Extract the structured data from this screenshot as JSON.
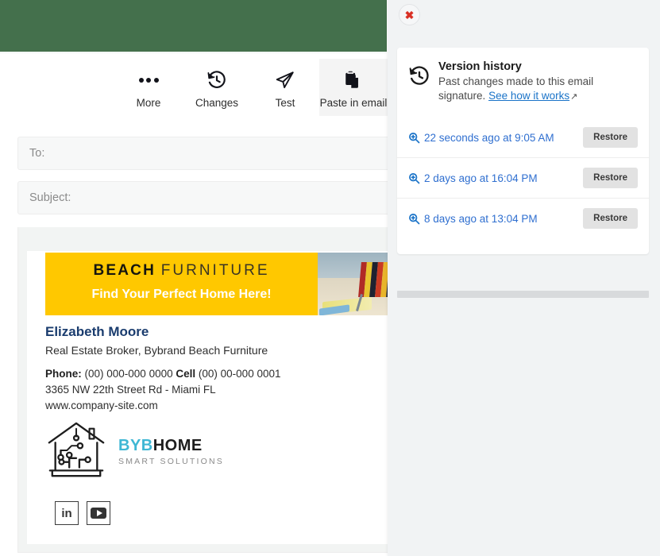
{
  "app": {
    "header_color": "#44704c",
    "panel_bg": "#f1f3f4"
  },
  "toolbar": {
    "items": [
      {
        "label": "More",
        "icon": "ellipsis-icon",
        "active": false
      },
      {
        "label": "Changes",
        "icon": "history-clock-icon",
        "active": false
      },
      {
        "label": "Test",
        "icon": "paper-plane-icon",
        "active": false
      },
      {
        "label": "Paste in email",
        "icon": "clipboard-paste-icon",
        "active": true
      }
    ]
  },
  "compose": {
    "to_label": "To:",
    "to_value": "",
    "subject_label": "Subject:",
    "subject_value": ""
  },
  "signature": {
    "banner": {
      "title_strong": "BEACH",
      "title_light": "FURNITURE",
      "subtitle": "Find Your Perfect Home Here!",
      "bg_color": "#ffc800"
    },
    "name": "Elizabeth Moore",
    "role": "Real Estate Broker,  Bybrand Beach Furniture",
    "phone_label": "Phone:",
    "phone_value": "(00) 000-000 0000",
    "cell_label": "Cell",
    "cell_value": "(00) 00-000 0001",
    "address": "3365 NW 22th Street Rd - Miami FL",
    "website": "www.company-site.com",
    "logo": {
      "brand_primary": "BYB",
      "brand_secondary": "HOME",
      "tagline": "SMART SOLUTIONS",
      "primary_color": "#3fb7d4"
    },
    "social": [
      {
        "name": "linkedin",
        "glyph": "in"
      },
      {
        "name": "youtube",
        "glyph": "play"
      }
    ]
  },
  "panel": {
    "close_label": "✖",
    "title": "Version history",
    "description": "Past changes made to this email signature.",
    "link_text": "See how it works",
    "link_external_icon": "↗",
    "versions": [
      {
        "label": "22 seconds ago at 9:05 AM",
        "action": "Restore"
      },
      {
        "label": "2 days ago at 16:04 PM",
        "action": "Restore"
      },
      {
        "label": "8 days ago at 13:04 PM",
        "action": "Restore"
      }
    ]
  }
}
